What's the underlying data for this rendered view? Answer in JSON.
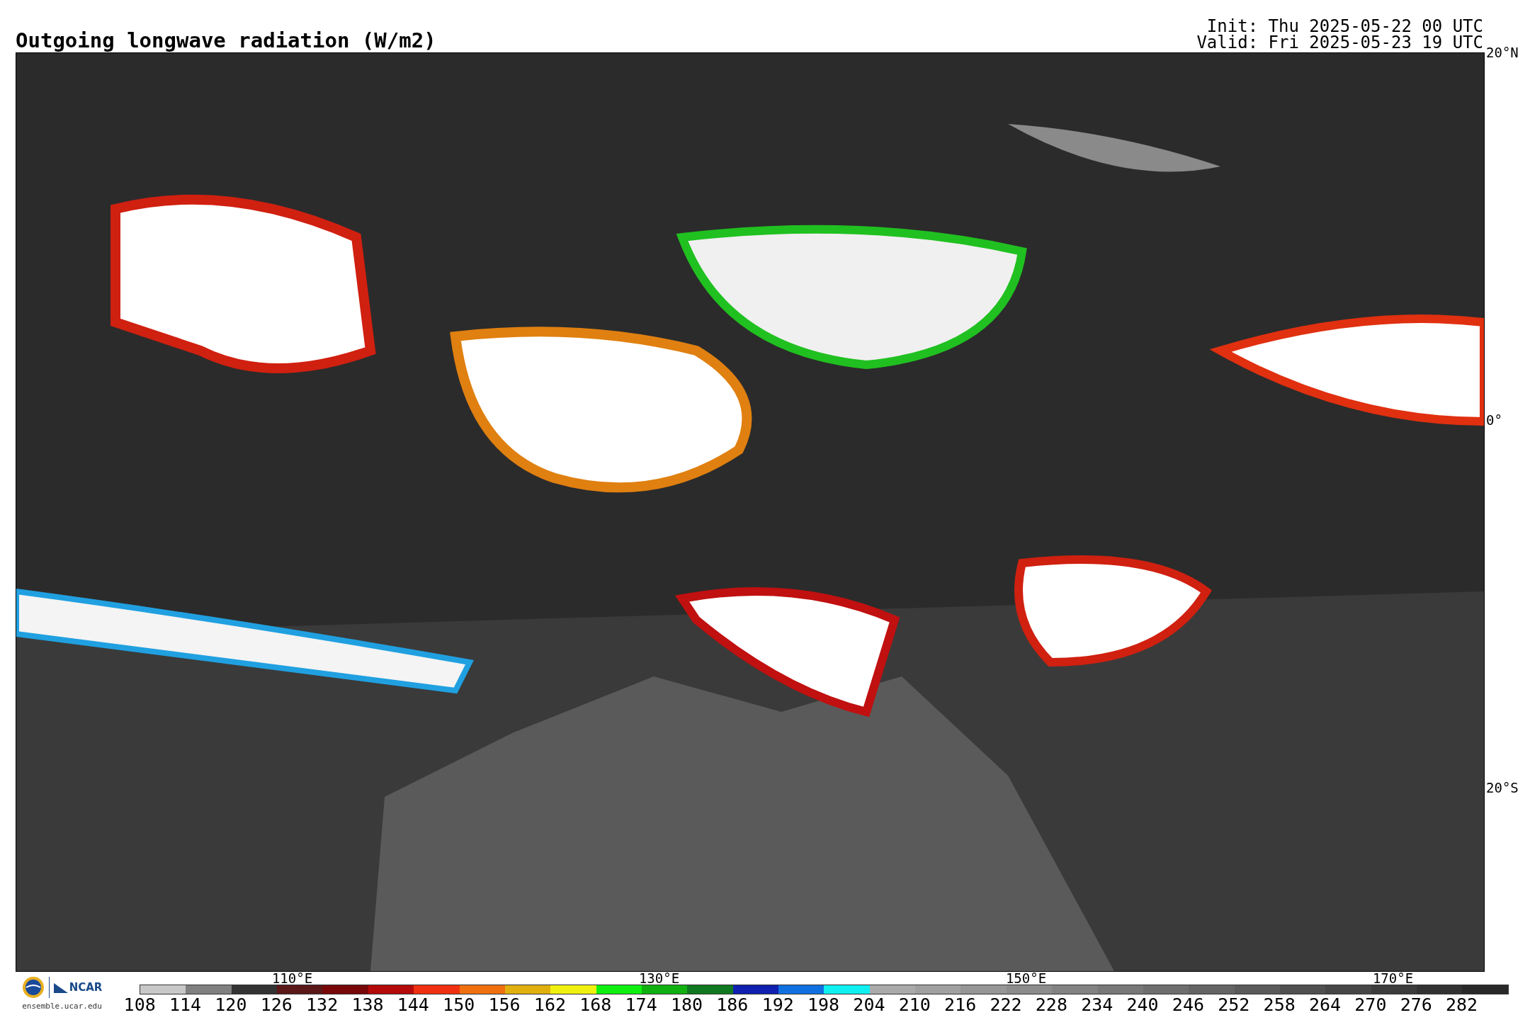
{
  "title": "Outgoing longwave radiation (W/m2)",
  "run_info": [
    "Init: Thu 2025-05-22 00 UTC",
    "Valid: Fri 2025-05-23 19 UTC"
  ],
  "map": {
    "latitude_labels": [
      "20°N",
      "0°",
      "20°S"
    ],
    "longitude_labels": [
      "110°E",
      "130°E",
      "150°E",
      "170°E"
    ]
  },
  "branding": {
    "logo_text": "NCAR",
    "url": "ensemble.ucar.edu"
  },
  "colorbar": {
    "bins": [
      {
        "color": "#c8c8c8"
      },
      {
        "color": "#808080"
      },
      {
        "color": "#333333"
      },
      {
        "color": "#5a1818"
      },
      {
        "color": "#780808"
      },
      {
        "color": "#b40a0a"
      },
      {
        "color": "#f03010"
      },
      {
        "color": "#f07010"
      },
      {
        "color": "#e0b010"
      },
      {
        "color": "#f0f010"
      },
      {
        "color": "#10f010"
      },
      {
        "color": "#10b010"
      },
      {
        "color": "#107820"
      },
      {
        "color": "#1020b0"
      },
      {
        "color": "#1070e0"
      },
      {
        "color": "#10f0f0"
      },
      {
        "color": "#aaaaaa"
      },
      {
        "color": "#a0a0a0"
      },
      {
        "color": "#969696"
      },
      {
        "color": "#8c8c8c"
      },
      {
        "color": "#828282"
      },
      {
        "color": "#787878"
      },
      {
        "color": "#6e6e6e"
      },
      {
        "color": "#646464"
      },
      {
        "color": "#5a5a5a"
      },
      {
        "color": "#505050"
      },
      {
        "color": "#464646"
      },
      {
        "color": "#3c3c3c"
      },
      {
        "color": "#323232"
      },
      {
        "color": "#282828"
      }
    ],
    "labels": [
      "108",
      "114",
      "120",
      "126",
      "132",
      "138",
      "144",
      "150",
      "156",
      "162",
      "168",
      "174",
      "180",
      "186",
      "192",
      "198",
      "204",
      "210",
      "216",
      "222",
      "228",
      "234",
      "240",
      "246",
      "252",
      "258",
      "264",
      "270",
      "276",
      "282"
    ]
  }
}
